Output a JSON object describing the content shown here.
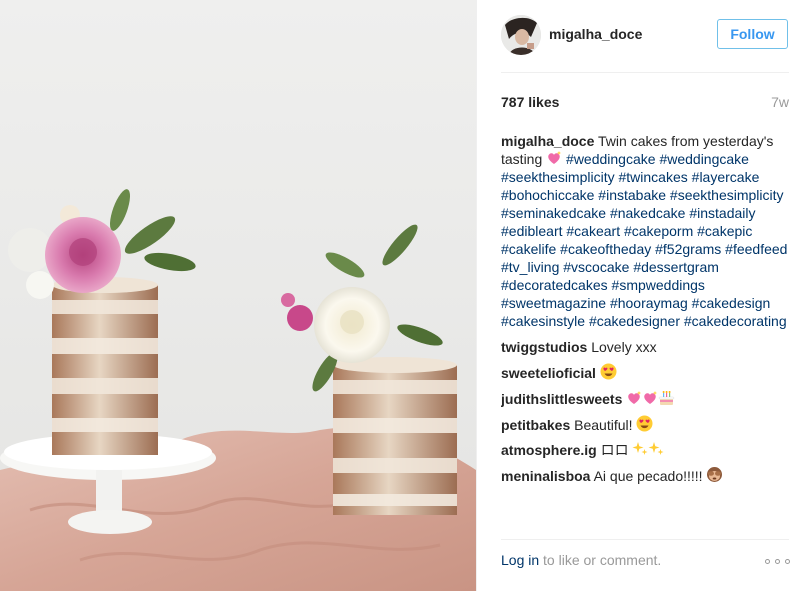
{
  "post": {
    "username": "migalha_doce",
    "follow_label": "Follow",
    "likes": "787 likes",
    "age": "7w"
  },
  "caption": {
    "username": "migalha_doce",
    "text": "Twin cakes from yesterday's tasting",
    "emoji": "sparkling-heart",
    "hashtags": [
      "#weddingcake",
      "#weddingcake",
      "#seekthesimplicity",
      "#twincakes",
      "#layercake",
      "#bohochiccake",
      "#instabake",
      "#seekthesimplicity",
      "#seminakedcake",
      "#nakedcake",
      "#instadaily",
      "#edibleart",
      "#cakeart",
      "#cakeporm",
      "#cakepic",
      "#cakelife",
      "#cakeoftheday",
      "#f52grams",
      "#feedfeed",
      "#tv_living",
      "#vscocake",
      "#dessertgram",
      "#decoratedcakes",
      "#smpweddings",
      "#sweetmagazine",
      "#hooraymag",
      "#cakedesign",
      "#cakesinstyle",
      "#cakedesigner",
      "#cakedecorating"
    ]
  },
  "comments": [
    {
      "username": "twiggstudios",
      "text": "Lovely xxx",
      "emojis": []
    },
    {
      "username": "sweetelioficial",
      "text": "",
      "emojis": [
        "heart-eyes-face"
      ]
    },
    {
      "username": "judithslittlesweets",
      "text": "",
      "emojis": [
        "sparkling-heart",
        "sparkling-heart",
        "birthday-cake"
      ]
    },
    {
      "username": "petitbakes",
      "text": "Beautiful!",
      "emojis": [
        "heart-eyes-face"
      ]
    },
    {
      "username": "atmosphere.ig",
      "text": "ロロ",
      "emojis": [
        "sparkles",
        "sparkles"
      ]
    },
    {
      "username": "meninalisboa",
      "text": "Ai que pecado!!!!!",
      "emojis": [
        "see-no-evil-monkey"
      ]
    }
  ],
  "footer": {
    "login_link": "Log in",
    "login_suffix": " to like or comment.",
    "more_icon": "more-options-icon"
  },
  "colors": {
    "link": "#003569",
    "follow_text": "#3897f0",
    "follow_border": "#70c0e9",
    "muted": "#999999",
    "text": "#262626",
    "photo_background": "#ededec",
    "cloth_pink": "#d9a99c"
  }
}
